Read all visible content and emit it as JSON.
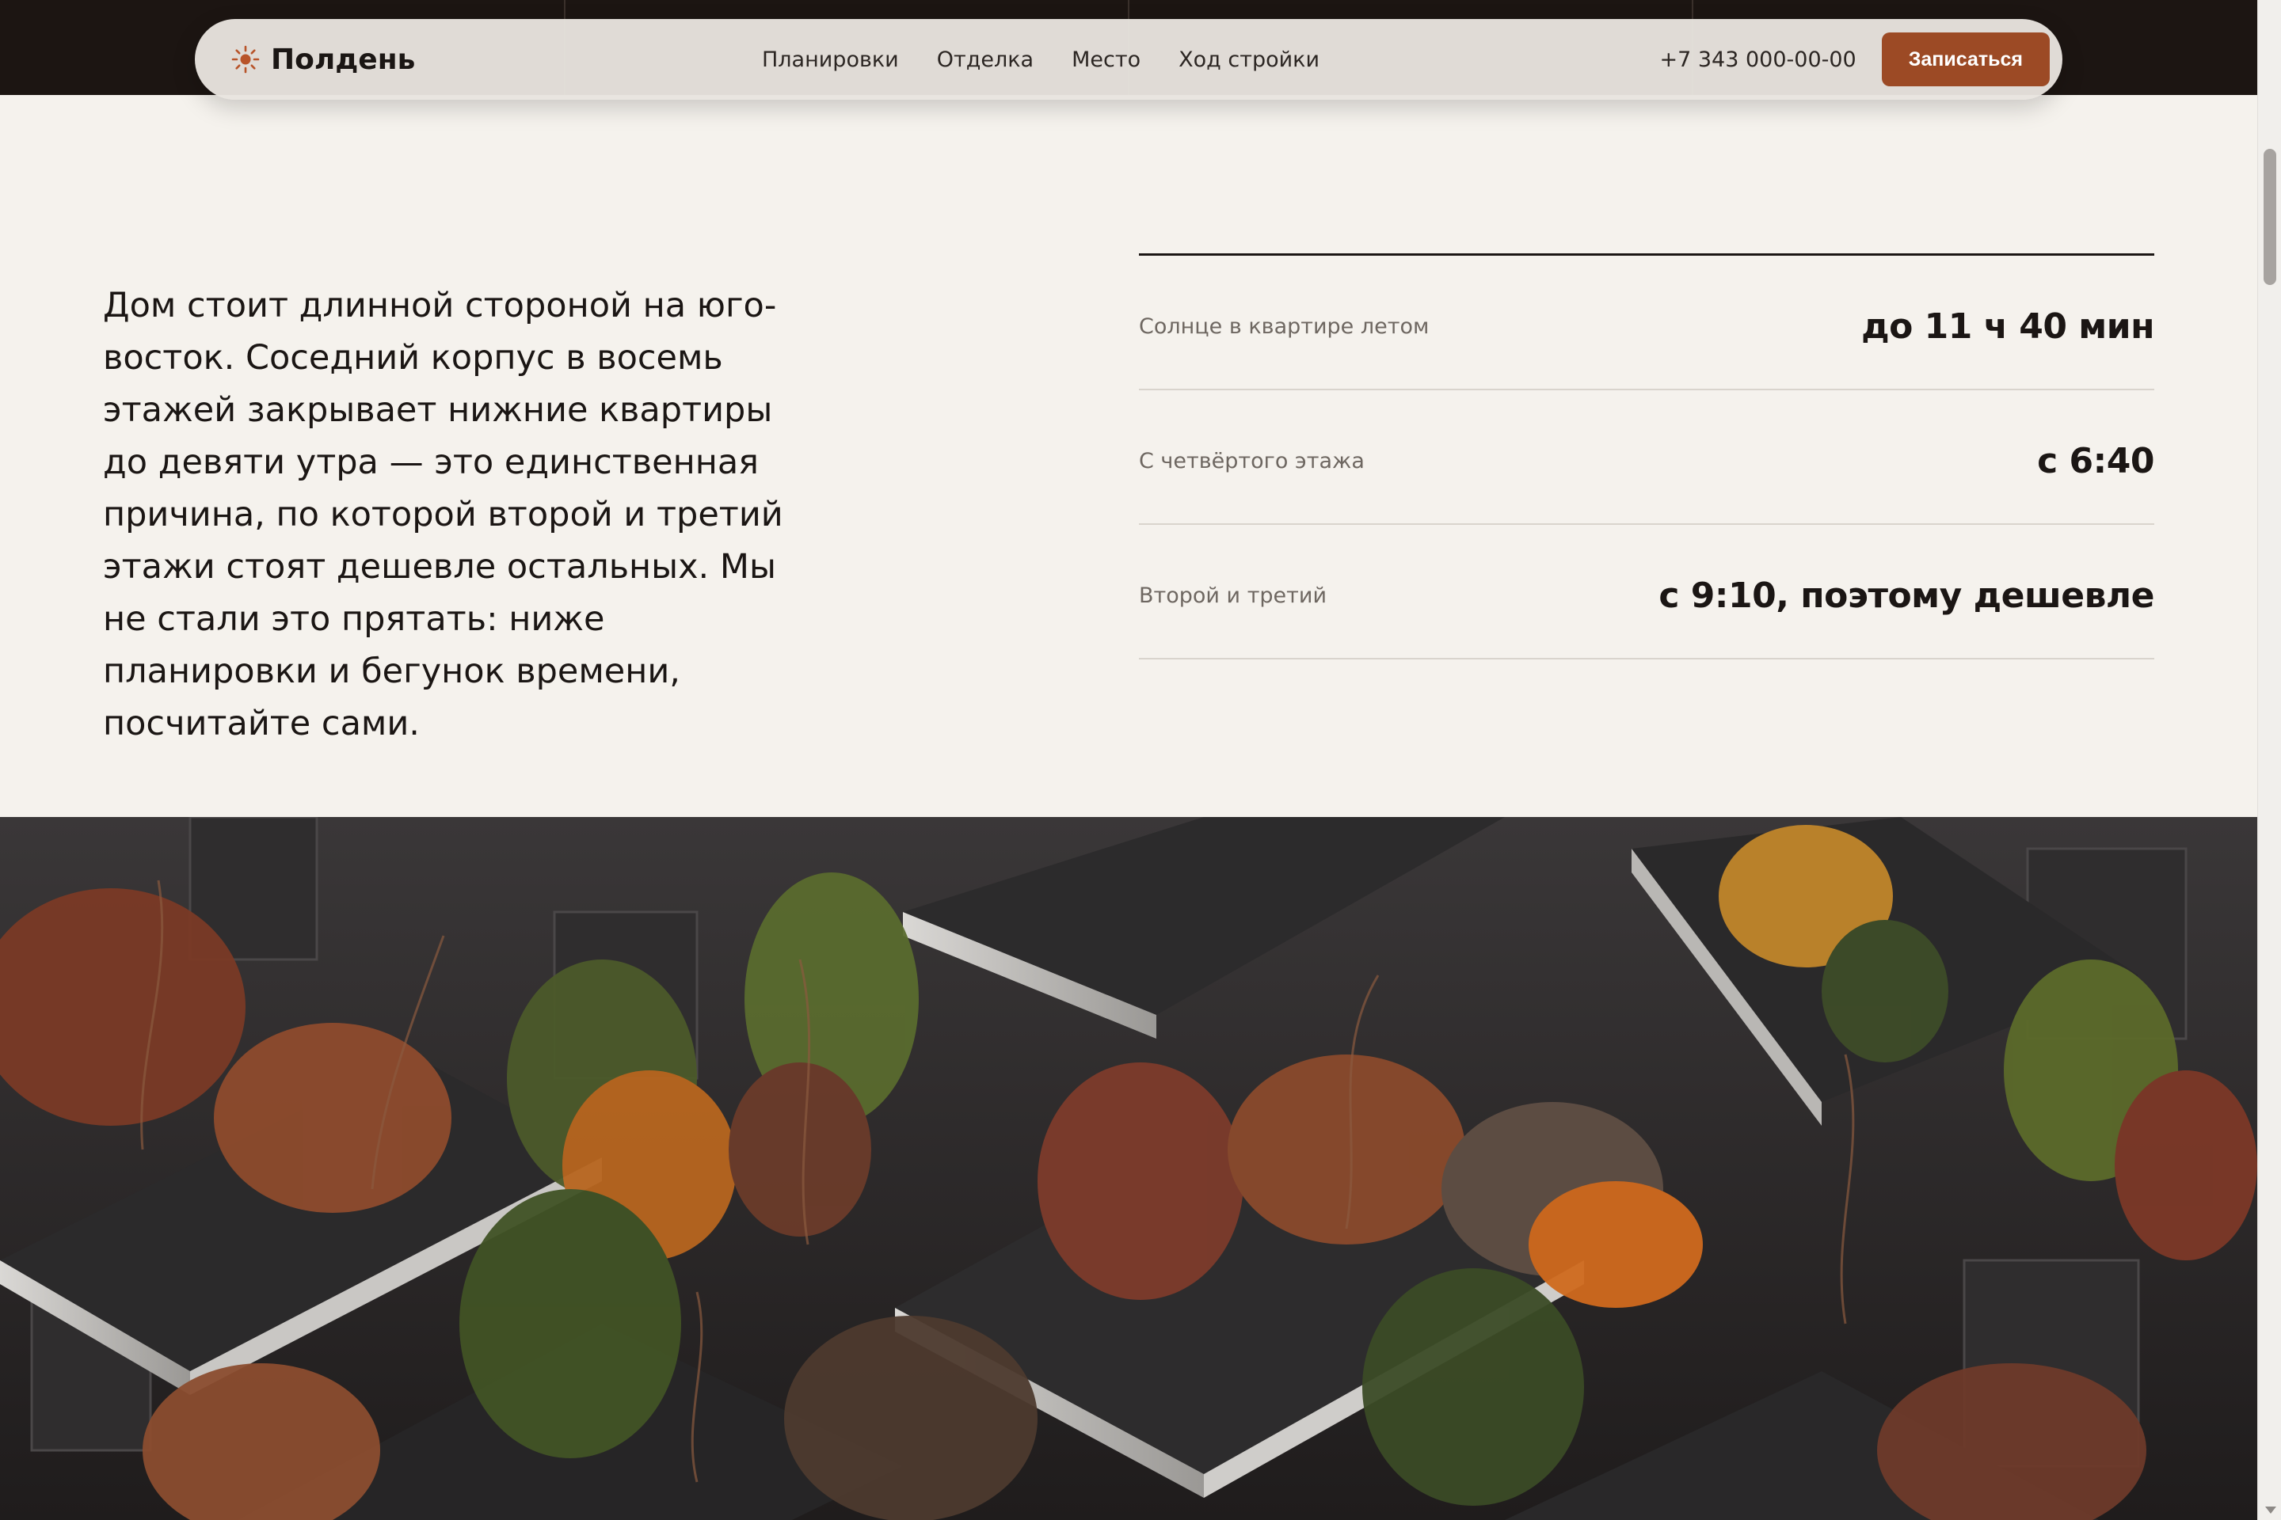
{
  "header": {
    "brand": "Полдень",
    "links": [
      "Планировки",
      "Отделка",
      "Место",
      "Ход стройки"
    ],
    "phone": "+7 343 000-00-00",
    "cta": "Записаться"
  },
  "intro": {
    "text": "Дом стоит длинной стороной на юго-восток. Соседний корпус в восемь этажей закрывает нижние квартиры до девяти утра — это единственная причина, по которой второй и третий этажи стоят дешевле остальных. Мы не стали это прятать: ниже планировки и бегунок времени, посчитайте сами."
  },
  "facts": [
    {
      "label": "Солнце в квартире летом",
      "value": "до 11 ч 40 мин"
    },
    {
      "label": "С четвёртого этажа",
      "value": "с 6:40"
    },
    {
      "label": "Второй и третий",
      "value": "с 9:10, поэтому дешевле"
    }
  ],
  "colors": {
    "accent": "#9c4a25",
    "background": "#f5f2ed",
    "dark": "#1c1512"
  }
}
